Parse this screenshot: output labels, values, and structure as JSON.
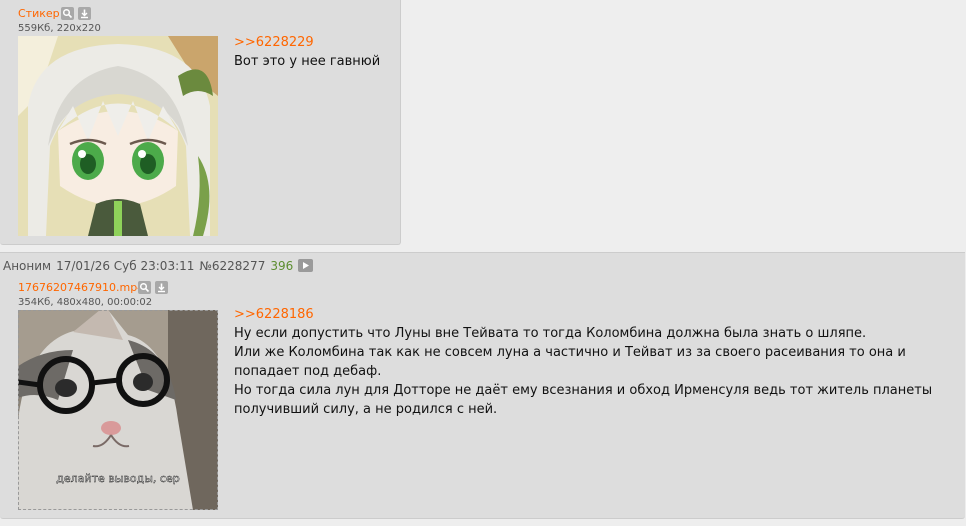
{
  "post1": {
    "file": {
      "name": "Стикер",
      "meta": "559Кб, 220x220"
    },
    "reply_to": ">>6228229",
    "lines": [
      "Вот это у нее гавнюй"
    ]
  },
  "post2": {
    "header": {
      "author": "Аноним",
      "date": "17/01/26 Суб 23:03:11",
      "number": "№6228277",
      "replies": "396"
    },
    "file": {
      "name": "17676207467910.mp4",
      "meta": "354Кб, 480x480, 00:00:02"
    },
    "caption": "делайте выводы, сер",
    "reply_to": ">>6228186",
    "lines": [
      "Ну если допустить что Луны вне Тейвата то тогда Коломбина должна была знать о шляпе.",
      "Или же Коломбина так как не совсем луна а частично и Тейват из за своего расеивания то она и",
      "попадает под дебаф.",
      "Но тогда сила лун для Дотторе не даёт ему всезнания и обход Ирменсуля ведь тот житель планеты",
      "получивший силу, а не родился с ней."
    ]
  },
  "colors": {
    "accent": "#ff6600",
    "post_bg": "#dddddd",
    "page_bg": "#eeeeee",
    "reply_count": "#5c8d2f"
  },
  "icons": [
    "search-icon",
    "download-icon",
    "play-icon"
  ]
}
